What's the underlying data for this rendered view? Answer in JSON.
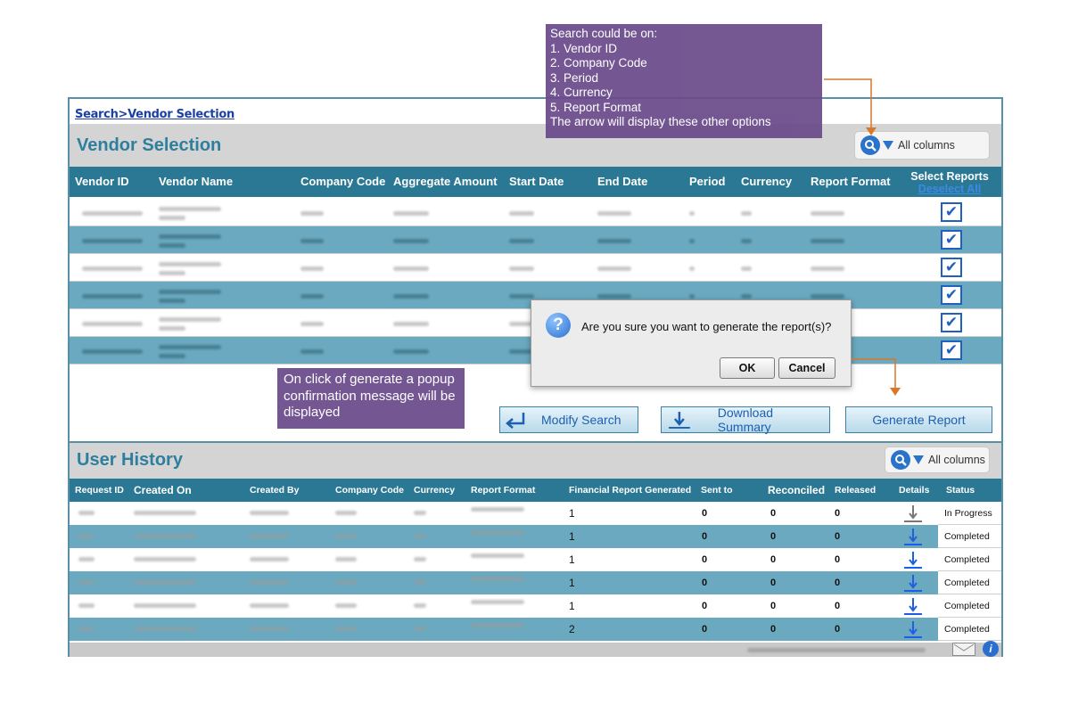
{
  "breadcrumb": {
    "search": "Search",
    "separator": ">",
    "current": "Vendor Selection"
  },
  "vendor_section": {
    "title": "Vendor Selection",
    "search_label": "All columns",
    "columns": [
      "Vendor ID",
      "Vendor Name",
      "Company Code",
      "Aggregate Amount",
      "Start Date",
      "End Date",
      "Period",
      "Currency",
      "Report Format"
    ],
    "select_header": "Select Reports",
    "deselect_all": "Deselect All",
    "rows": [
      {
        "checked": true
      },
      {
        "checked": true
      },
      {
        "checked": true
      },
      {
        "checked": true
      },
      {
        "checked": true
      },
      {
        "checked": true
      }
    ]
  },
  "actions": {
    "modify_search": "Modify Search",
    "download_summary": "Download Summary",
    "generate_report": "Generate Report"
  },
  "history_section": {
    "title": "User History",
    "search_label": "All columns",
    "columns": [
      "Request ID",
      "Created On",
      "Created By",
      "Company Code",
      "Currency",
      "Report Format",
      "Financial Report Generated",
      "Sent to",
      "Reconciled",
      "Released",
      "Details",
      "Status"
    ],
    "rows": [
      {
        "generated": "1",
        "sent": "0",
        "reconciled": "0",
        "released": "0",
        "status": "In Progress"
      },
      {
        "generated": "1",
        "sent": "0",
        "reconciled": "0",
        "released": "0",
        "status": "Completed"
      },
      {
        "generated": "1",
        "sent": "0",
        "reconciled": "0",
        "released": "0",
        "status": "Completed"
      },
      {
        "generated": "1",
        "sent": "0",
        "reconciled": "0",
        "released": "0",
        "status": "Completed"
      },
      {
        "generated": "1",
        "sent": "0",
        "reconciled": "0",
        "released": "0",
        "status": "Completed"
      },
      {
        "generated": "2",
        "sent": "0",
        "reconciled": "0",
        "released": "0",
        "status": "Completed"
      }
    ]
  },
  "popup": {
    "message": "Are you sure you want to generate the report(s)?",
    "ok": "OK",
    "cancel": "Cancel"
  },
  "notes": {
    "search_note": {
      "intro": "Search could be on:",
      "items": [
        "1.  Vendor ID",
        "2.  Company Code",
        "3.  Period",
        "4.  Currency",
        "5.  Report Format"
      ],
      "outro": "The arrow will display these other options"
    },
    "popup_note": "On click of generate a popup confirmation message will be displayed"
  },
  "colors": {
    "header_teal": "#2a7893",
    "alt_row": "#6aa9bf",
    "title_teal": "#2e7f9e",
    "note_purple": "#6a4a8a",
    "arrow_orange": "#d9772a",
    "link_blue": "#1d3fa8"
  }
}
